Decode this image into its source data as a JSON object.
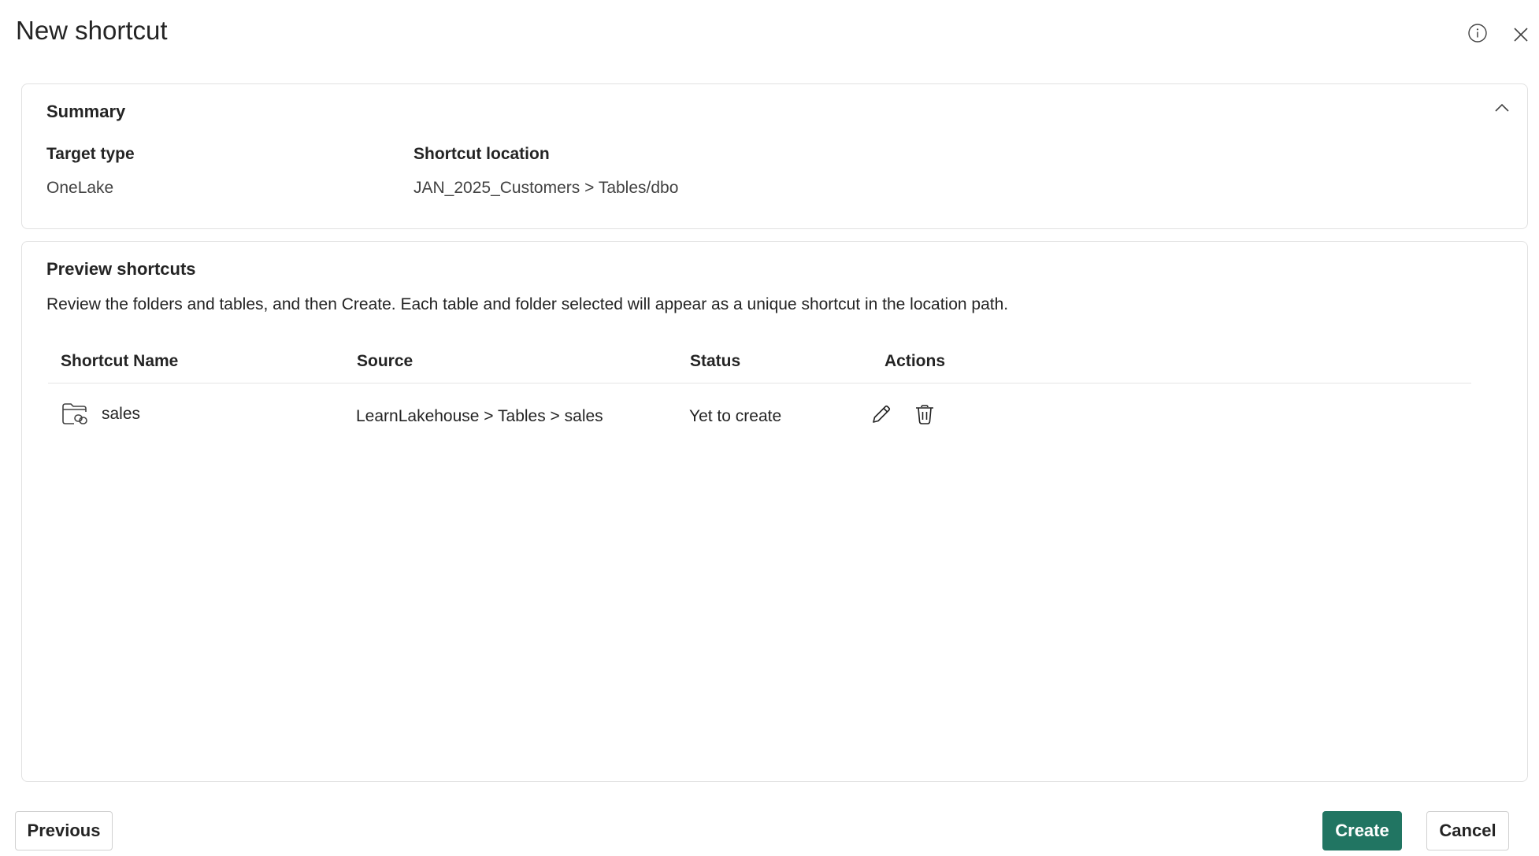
{
  "dialog": {
    "title": "New shortcut",
    "icons": {
      "info": "info-icon",
      "close": "close-icon"
    }
  },
  "summary": {
    "title": "Summary",
    "collapse_icon": "chevron-up-icon",
    "target_type_label": "Target type",
    "target_type_value": "OneLake",
    "shortcut_location_label": "Shortcut location",
    "shortcut_location_value": "JAN_2025_Customers > Tables/dbo"
  },
  "preview": {
    "title": "Preview shortcuts",
    "description": "Review the folders and tables, and then Create. Each table and folder selected will appear as a unique shortcut in the location path.",
    "columns": [
      "Shortcut Name",
      "Source",
      "Status",
      "Actions"
    ],
    "rows": [
      {
        "icon": "folder-link-icon",
        "name": "sales",
        "source": "LearnLakehouse > Tables > sales",
        "status": "Yet to create",
        "actions": [
          "edit-icon",
          "delete-icon"
        ]
      }
    ]
  },
  "footer": {
    "previous_label": "Previous",
    "create_label": "Create",
    "cancel_label": "Cancel"
  },
  "colors": {
    "primary": "#217562",
    "border": "#e1e1e1",
    "text": "#242424"
  }
}
